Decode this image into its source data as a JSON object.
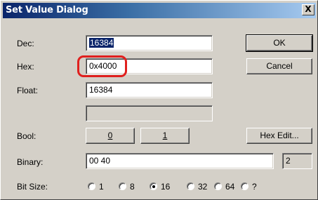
{
  "window": {
    "title": "Set Value Dialog",
    "close_glyph": "X"
  },
  "labels": {
    "dec": "Dec:",
    "hex": "Hex:",
    "float": "Float:",
    "bool": "Bool:",
    "binary": "Binary:",
    "bit_size": "Bit Size:"
  },
  "fields": {
    "dec": "16384",
    "hex": "0x4000",
    "float": "16384",
    "empty": "",
    "binary": "00 40",
    "binary_count": "2"
  },
  "buttons": {
    "ok": "OK",
    "cancel": "Cancel",
    "bool_0": "0",
    "bool_1": "1",
    "hex_edit": "Hex Edit..."
  },
  "bit_size": {
    "options": [
      "1",
      "8",
      "16",
      "32",
      "64",
      "?"
    ],
    "selected": "16"
  },
  "colors": {
    "title_start": "#0a246a",
    "title_end": "#a6caf0",
    "face": "#d4d0c8",
    "highlight": "#e0201e"
  }
}
